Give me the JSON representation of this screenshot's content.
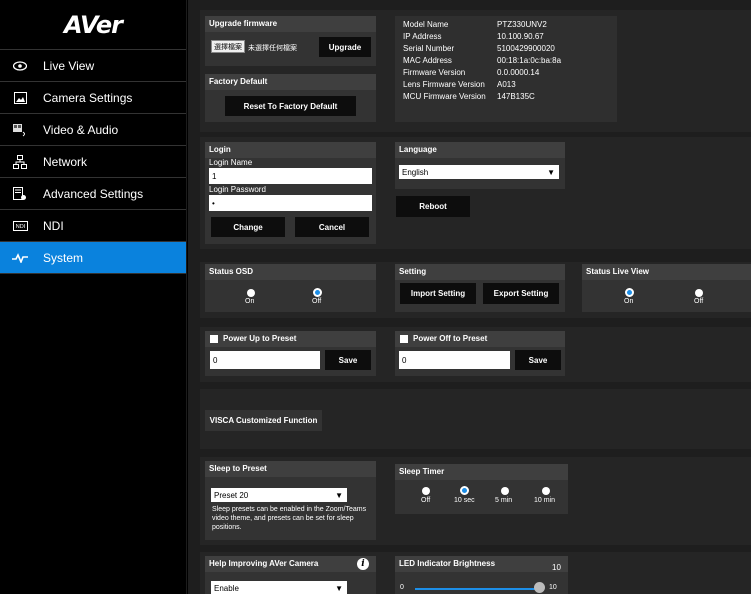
{
  "sidebar": {
    "logo": "AVer",
    "items": [
      {
        "label": "Live View",
        "icon": "eye-icon"
      },
      {
        "label": "Camera Settings",
        "icon": "image-icon"
      },
      {
        "label": "Video & Audio",
        "icon": "video-audio-icon"
      },
      {
        "label": "Network",
        "icon": "network-icon"
      },
      {
        "label": "Advanced Settings",
        "icon": "advanced-settings-icon"
      },
      {
        "label": "NDI",
        "icon": "ndi-icon"
      },
      {
        "label": "System",
        "icon": "pulse-icon",
        "active": true
      }
    ]
  },
  "upgrade": {
    "title": "Upgrade firmware",
    "choose_file": "選擇檔案",
    "no_file": "未選擇任何檔案",
    "upgrade_button": "Upgrade"
  },
  "factory": {
    "title": "Factory Default",
    "reset_button": "Reset To Factory Default"
  },
  "info": {
    "rows": [
      {
        "label": "Model Name",
        "value": "PTZ330UNV2"
      },
      {
        "label": "IP Address",
        "value": "10.100.90.67"
      },
      {
        "label": "Serial Number",
        "value": "5100429900020"
      },
      {
        "label": "MAC Address",
        "value": "00:18:1a:0c:ba:8a"
      },
      {
        "label": "Firmware Version",
        "value": "0.0.0000.14"
      },
      {
        "label": "Lens Firmware Version",
        "value": "A013"
      },
      {
        "label": "MCU Firmware Version",
        "value": "147B135C"
      }
    ]
  },
  "login": {
    "title": "Login",
    "name_label": "Login Name",
    "name_value": "1",
    "password_label": "Login Password",
    "password_value": "•",
    "change_button": "Change",
    "cancel_button": "Cancel"
  },
  "language": {
    "title": "Language",
    "selected": "English",
    "reboot_button": "Reboot"
  },
  "status_osd": {
    "title": "Status OSD",
    "on": "On",
    "off": "Off",
    "selected": "Off"
  },
  "setting": {
    "title": "Setting",
    "import_button": "Import Setting",
    "export_button": "Export Setting"
  },
  "status_live": {
    "title": "Status Live View",
    "on": "On",
    "off": "Off",
    "selected": "On"
  },
  "power_up": {
    "label": "Power Up to Preset",
    "value": "0",
    "save_button": "Save"
  },
  "power_off": {
    "label": "Power Off to Preset",
    "value": "0",
    "save_button": "Save"
  },
  "visca": {
    "button": "VISCA Customized Function"
  },
  "sleep_preset": {
    "title": "Sleep to Preset",
    "selected": "Preset 20",
    "note": "Sleep presets can be enabled in the Zoom/Teams video theme, and presets can be set for sleep positions."
  },
  "sleep_timer": {
    "title": "Sleep Timer",
    "options": [
      "Off",
      "10 sec",
      "5 min",
      "10 min"
    ],
    "selected": "10 sec"
  },
  "help": {
    "title": "Help Improving AVer Camera",
    "selected": "Enable"
  },
  "led": {
    "title": "LED Indicator Brightness",
    "value": "10",
    "min": "0",
    "max": "10",
    "level": 1.0
  },
  "colors": {
    "accent": "#0a82dd",
    "panel": "#333333",
    "header": "#3f3f3f"
  }
}
